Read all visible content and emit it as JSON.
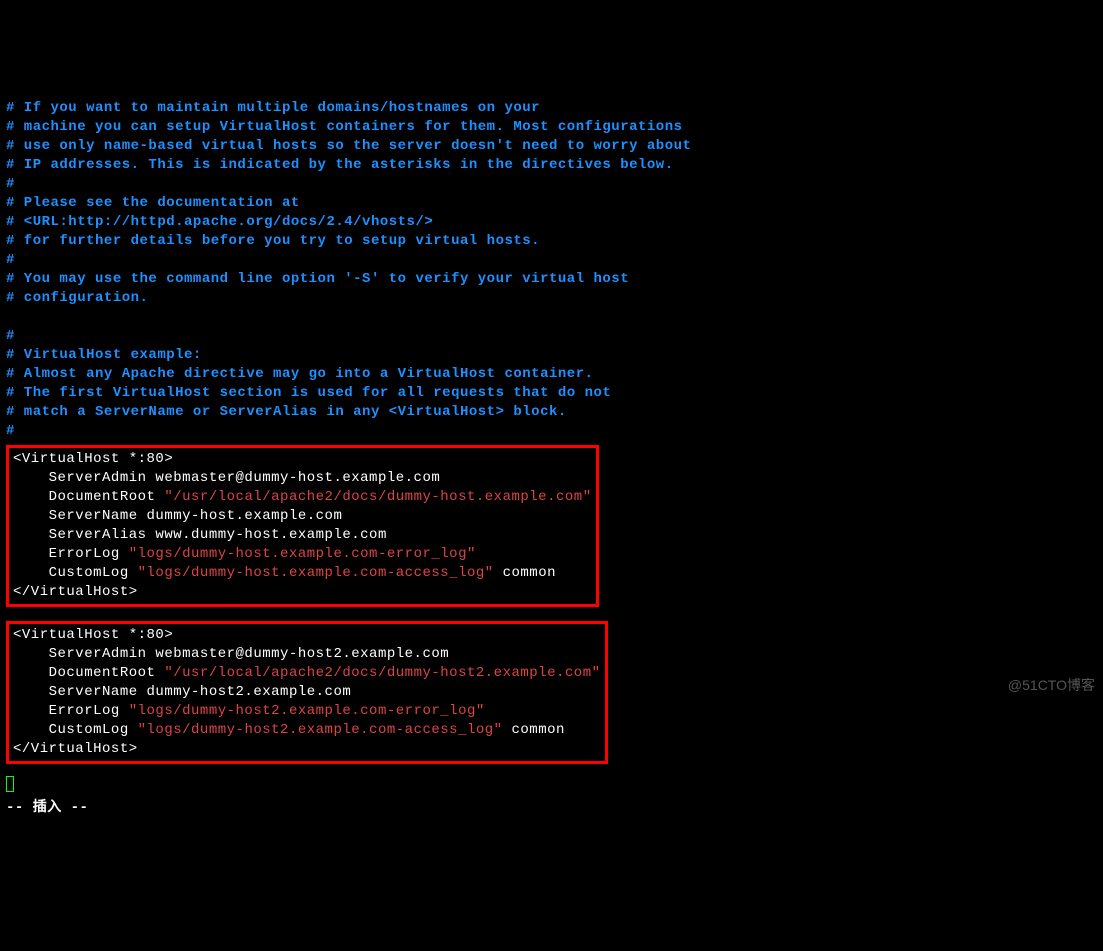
{
  "comments": {
    "l1": "# If you want to maintain multiple domains/hostnames on your",
    "l2": "# machine you can setup VirtualHost containers for them. Most configurations",
    "l3": "# use only name-based virtual hosts so the server doesn't need to worry about",
    "l4": "# IP addresses. This is indicated by the asterisks in the directives below.",
    "l5": "#",
    "l6": "# Please see the documentation at",
    "l7": "# <URL:http://httpd.apache.org/docs/2.4/vhosts/>",
    "l8": "# for further details before you try to setup virtual hosts.",
    "l9": "#",
    "l10": "# You may use the command line option '-S' to verify your virtual host",
    "l11": "# configuration.",
    "l12": "",
    "l13": "#",
    "l14": "# VirtualHost example:",
    "l15": "# Almost any Apache directive may go into a VirtualHost container.",
    "l16": "# The first VirtualHost section is used for all requests that do not",
    "l17": "# match a ServerName or ServerAlias in any <VirtualHost> block.",
    "l18": "#"
  },
  "vhost1": {
    "open": "<VirtualHost *:80>",
    "serverAdmin": "    ServerAdmin webmaster@dummy-host.example.com",
    "docRootKey": "    DocumentRoot ",
    "docRootVal": "\"/usr/local/apache2/docs/dummy-host.example.com\"",
    "serverName": "    ServerName dummy-host.example.com",
    "serverAlias": "    ServerAlias www.dummy-host.example.com",
    "errorKey": "    ErrorLog ",
    "errorVal": "\"logs/dummy-host.example.com-error_log\"",
    "customKey": "    CustomLog ",
    "customVal": "\"logs/dummy-host.example.com-access_log\"",
    "customTail": " common",
    "close": "</VirtualHost>"
  },
  "vhost2": {
    "open": "<VirtualHost *:80>",
    "serverAdmin": "    ServerAdmin webmaster@dummy-host2.example.com",
    "docRootKey": "    DocumentRoot ",
    "docRootVal": "\"/usr/local/apache2/docs/dummy-host2.example.com\"",
    "serverName": "    ServerName dummy-host2.example.com",
    "errorKey": "    ErrorLog ",
    "errorVal": "\"logs/dummy-host2.example.com-error_log\"",
    "customKey": "    CustomLog ",
    "customVal": "\"logs/dummy-host2.example.com-access_log\"",
    "customTail": " common",
    "close": "</VirtualHost>"
  },
  "statusline": "-- 插入 --",
  "watermark": "@51CTO博客"
}
